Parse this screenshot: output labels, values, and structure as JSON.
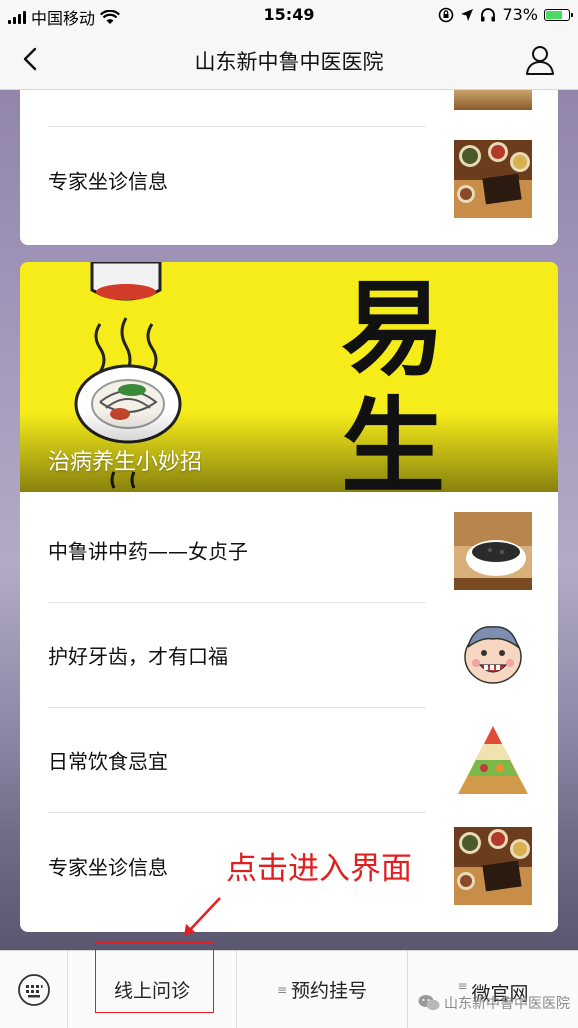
{
  "status_bar": {
    "carrier": "中国移动",
    "time": "15:49",
    "battery_percent": "73%",
    "battery_level": 0.73
  },
  "nav": {
    "title": "山东新中鲁中医医院"
  },
  "top_card": {
    "items": [
      {
        "title": "专家坐诊信息"
      }
    ]
  },
  "banner": {
    "caption": "治病养生小妙招",
    "art_text": "易生"
  },
  "list_card": {
    "items": [
      {
        "title": "中鲁讲中药——女贞子"
      },
      {
        "title": "护好牙齿，才有口福"
      },
      {
        "title": "日常饮食忌宜"
      },
      {
        "title": "专家坐诊信息"
      }
    ]
  },
  "annotation": {
    "text": "点击进入界面",
    "color": "#e02020"
  },
  "tab_bar": {
    "tabs": [
      {
        "label": "线上问诊"
      },
      {
        "label": "预约挂号"
      },
      {
        "label": "微官网"
      }
    ]
  },
  "watermark": {
    "text": "山东新中鲁中医医院"
  }
}
